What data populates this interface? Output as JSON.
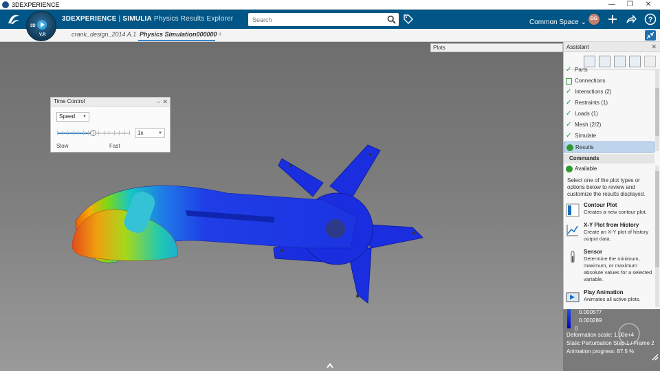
{
  "window": {
    "title": "3DEXPERIENCE",
    "min": "—",
    "restore": "❐",
    "close": "✕"
  },
  "header": {
    "brand_bold": "3DEXPERIENCE",
    "brand_sep": " | ",
    "brand_product": "SIMULIA",
    "brand_app": " Physics Results Explorer",
    "search_placeholder": "Search",
    "space": "Common Space",
    "avatar_initials": "DG"
  },
  "compass": {
    "left": "3D",
    "right": "V.R"
  },
  "tabs": [
    {
      "label": "crank_design_2014 A.1"
    },
    {
      "label": "Physics Simulation000000",
      "active": true
    }
  ],
  "add_tab": "+",
  "plots": {
    "label": "Plots"
  },
  "time_control": {
    "title": "Time Control",
    "mode": "Speed",
    "speed_value": "1x",
    "slow_label": "Slow",
    "fast_label": "Fast",
    "slider_fraction": 0.5
  },
  "assistant": {
    "title": "Assistant",
    "steps": [
      {
        "label": "Parts",
        "state": "check"
      },
      {
        "label": "Connections",
        "state": "box"
      },
      {
        "label": "Interactions (2)",
        "state": "check"
      },
      {
        "label": "Restraints (1)",
        "state": "check"
      },
      {
        "label": "Loads (1)",
        "state": "check"
      },
      {
        "label": "Mesh (2/2)",
        "state": "check"
      },
      {
        "label": "Simulate",
        "state": "check"
      },
      {
        "label": "Results",
        "state": "dot",
        "selected": true
      }
    ],
    "commands_header": "Commands",
    "available": "Available",
    "intro": "Select one of the plot types or options below to review and customize the results displayed.",
    "commands": [
      {
        "title": "Contour Plot",
        "desc": "Creates a new contour plot."
      },
      {
        "title": "X-Y Plot from History",
        "desc": "Create an X-Y plot of history output data."
      },
      {
        "title": "Sensor",
        "desc": "Determine the minimum, maximum, or maximum absolute values for a selected variable."
      },
      {
        "title": "Play Animation",
        "desc": "Animates all active plots."
      }
    ]
  },
  "legend": {
    "values": [
      "0.000577",
      "0.000289",
      "0"
    ]
  },
  "status": {
    "deformation": "Deformation scale: 1.00e+4",
    "step": "Static Perturbation Step.1 / Frame 2",
    "progress": "Animation progress: 87.5 %"
  },
  "colors": {
    "header": "#005686",
    "accent": "#3b86c6",
    "check": "#2e9a2e"
  }
}
